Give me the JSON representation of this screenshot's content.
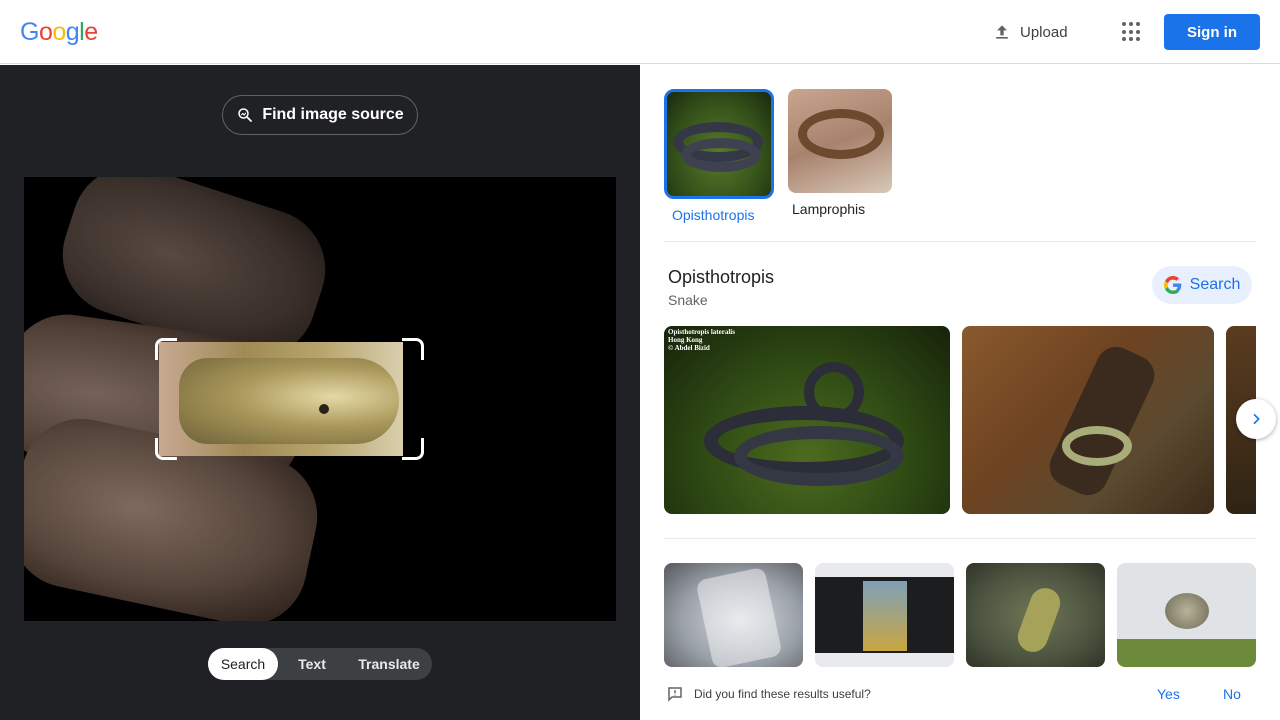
{
  "header": {
    "logo_letters": [
      {
        "ch": "G",
        "color": "#4285f4"
      },
      {
        "ch": "o",
        "color": "#ea4335"
      },
      {
        "ch": "o",
        "color": "#fbbc05"
      },
      {
        "ch": "g",
        "color": "#4285f4"
      },
      {
        "ch": "l",
        "color": "#34a853"
      },
      {
        "ch": "e",
        "color": "#ea4335"
      }
    ],
    "upload_label": "Upload",
    "upload_icon": "upload-icon",
    "apps_icon": "apps-grid-icon",
    "signin_label": "Sign in"
  },
  "left_panel": {
    "find_source_label": "Find image source",
    "find_source_icon": "image-search-icon",
    "modes": [
      {
        "label": "Search",
        "active": true
      },
      {
        "label": "Text",
        "active": false
      },
      {
        "label": "Translate",
        "active": false
      }
    ]
  },
  "right_panel": {
    "categories": [
      {
        "label": "Opisthotropis",
        "selected": true
      },
      {
        "label": "Lamprophis",
        "selected": false
      }
    ],
    "knowledge": {
      "title": "Opisthotropis",
      "subtitle": "Snake",
      "search_label": "Search"
    },
    "big_image_caption": "Opisthotropis lateralis\nHong Kong\n© Abdel Bizid",
    "feedback": {
      "question": "Did you find these results useful?",
      "yes": "Yes",
      "no": "No"
    }
  },
  "colors": {
    "accent": "#1a73e8",
    "dark_panel": "#202124"
  }
}
